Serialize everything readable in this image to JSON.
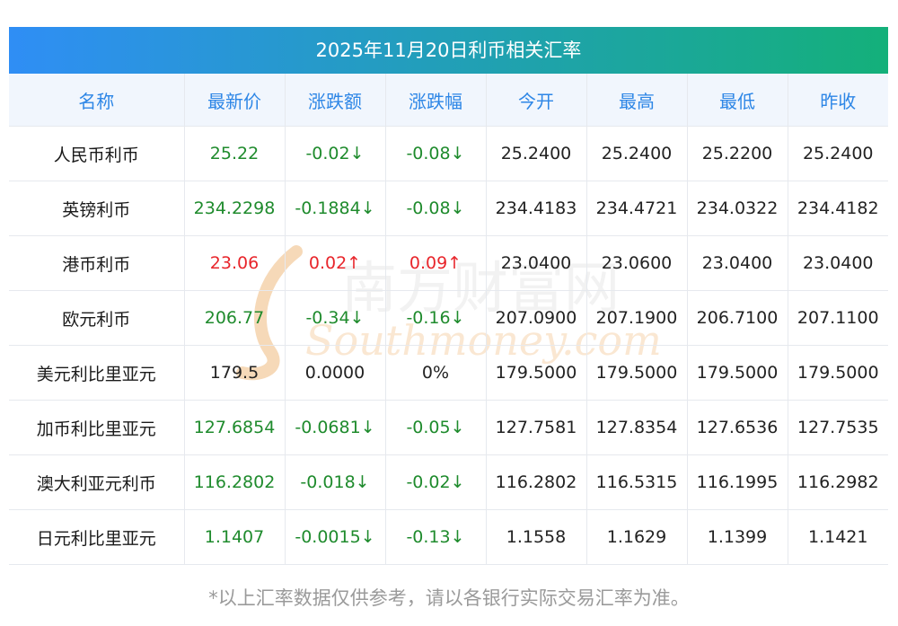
{
  "title": "2025年11月20日利币相关汇率",
  "headers": [
    "名称",
    "最新价",
    "涨跌额",
    "涨跌幅",
    "今开",
    "最高",
    "最低",
    "昨收"
  ],
  "rows": [
    {
      "name": "人民币利币",
      "latest": "25.22",
      "change": "-0.02↓",
      "pct": "-0.08↓",
      "open": "25.2400",
      "high": "25.2400",
      "low": "25.2200",
      "prev": "25.2400",
      "trend": "down"
    },
    {
      "name": "英镑利币",
      "latest": "234.2298",
      "change": "-0.1884↓",
      "pct": "-0.08↓",
      "open": "234.4183",
      "high": "234.4721",
      "low": "234.0322",
      "prev": "234.4182",
      "trend": "down"
    },
    {
      "name": "港币利币",
      "latest": "23.06",
      "change": "0.02↑",
      "pct": "0.09↑",
      "open": "23.0400",
      "high": "23.0600",
      "low": "23.0400",
      "prev": "23.0400",
      "trend": "up"
    },
    {
      "name": "欧元利币",
      "latest": "206.77",
      "change": "-0.34↓",
      "pct": "-0.16↓",
      "open": "207.0900",
      "high": "207.1900",
      "low": "206.7100",
      "prev": "207.1100",
      "trend": "down"
    },
    {
      "name": "美元利比里亚元",
      "latest": "179.5",
      "change": "0.0000",
      "pct": "0%",
      "open": "179.5000",
      "high": "179.5000",
      "low": "179.5000",
      "prev": "179.5000",
      "trend": "flat"
    },
    {
      "name": "加币利比里亚元",
      "latest": "127.6854",
      "change": "-0.0681↓",
      "pct": "-0.05↓",
      "open": "127.7581",
      "high": "127.8354",
      "low": "127.6536",
      "prev": "127.7535",
      "trend": "down"
    },
    {
      "name": "澳大利亚元利币",
      "latest": "116.2802",
      "change": "-0.018↓",
      "pct": "-0.02↓",
      "open": "116.2802",
      "high": "116.5315",
      "low": "116.1995",
      "prev": "116.2982",
      "trend": "down"
    },
    {
      "name": "日元利比里亚元",
      "latest": "1.1407",
      "change": "-0.0015↓",
      "pct": "-0.13↓",
      "open": "1.1558",
      "high": "1.1629",
      "low": "1.1399",
      "prev": "1.1421",
      "trend": "down"
    }
  ],
  "watermark": {
    "cn": "南方财富网",
    "en": "Southmoney.com"
  },
  "note": "*以上汇率数据仅供参考，请以各银行实际交易汇率为准。",
  "colors": {
    "up": "#e8252b",
    "down": "#1f8b2d",
    "header_text": "#2d86e6",
    "title_from": "#2f8ef5",
    "title_to": "#14b07a"
  }
}
